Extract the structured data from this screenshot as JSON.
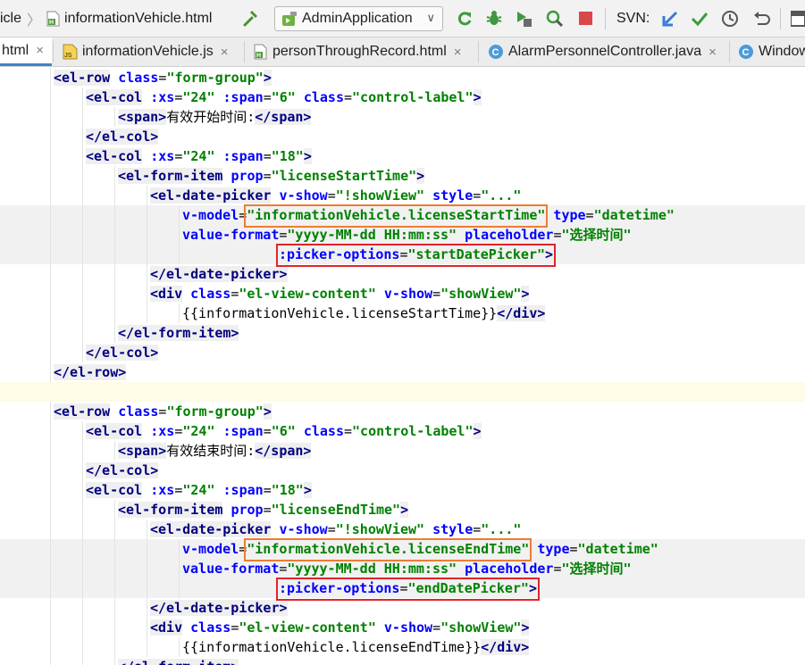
{
  "toolbar": {
    "breadcrumb_prefix": "icle",
    "breadcrumb_file": "informationVehicle.html",
    "run_config": "AdminApplication",
    "svn_label": "SVN:"
  },
  "tabs": [
    {
      "label": "html",
      "close": "×",
      "active": true
    },
    {
      "label": "informationVehicle.js",
      "close": "×",
      "active": false
    },
    {
      "label": "personThroughRecord.html",
      "close": "×",
      "active": false
    },
    {
      "label": "AlarmPersonnelController.java",
      "close": "×",
      "active": false
    },
    {
      "label": "Window",
      "close": "",
      "active": false
    }
  ],
  "colors": {
    "highlight_orange": "#ed7d31",
    "highlight_red": "#e2232b",
    "tag": "#000080",
    "attribute": "#0000ff",
    "value": "#008000"
  },
  "code_lines": [
    {
      "indent": 4,
      "tokens": [
        {
          "t": "t",
          "s": "<el-row"
        },
        {
          "t": "p",
          "s": " "
        },
        {
          "t": "a",
          "s": "class"
        },
        {
          "t": "p",
          "s": "="
        },
        {
          "t": "v",
          "s": "\"form-group\""
        },
        {
          "t": "t",
          "s": ">"
        }
      ]
    },
    {
      "indent": 8,
      "tokens": [
        {
          "t": "t",
          "s": "<el-col"
        },
        {
          "t": "p",
          "s": " "
        },
        {
          "t": "a",
          "s": ":xs"
        },
        {
          "t": "p",
          "s": "="
        },
        {
          "t": "v",
          "s": "\"24\""
        },
        {
          "t": "p",
          "s": " "
        },
        {
          "t": "a",
          "s": ":span"
        },
        {
          "t": "p",
          "s": "="
        },
        {
          "t": "v",
          "s": "\"6\""
        },
        {
          "t": "p",
          "s": " "
        },
        {
          "t": "a",
          "s": "class"
        },
        {
          "t": "p",
          "s": "="
        },
        {
          "t": "v",
          "s": "\"control-label\""
        },
        {
          "t": "t",
          "s": ">"
        }
      ]
    },
    {
      "indent": 12,
      "tokens": [
        {
          "t": "t",
          "s": "<span>"
        },
        {
          "t": "p",
          "s": "有效开始时间:"
        },
        {
          "t": "t",
          "s": "</span>"
        }
      ]
    },
    {
      "indent": 8,
      "tokens": [
        {
          "t": "t",
          "s": "</el-col>"
        }
      ]
    },
    {
      "indent": 8,
      "tokens": [
        {
          "t": "t",
          "s": "<el-col"
        },
        {
          "t": "p",
          "s": " "
        },
        {
          "t": "a",
          "s": ":xs"
        },
        {
          "t": "p",
          "s": "="
        },
        {
          "t": "v",
          "s": "\"24\""
        },
        {
          "t": "p",
          "s": " "
        },
        {
          "t": "a",
          "s": ":span"
        },
        {
          "t": "p",
          "s": "="
        },
        {
          "t": "v",
          "s": "\"18\""
        },
        {
          "t": "t",
          "s": ">"
        }
      ]
    },
    {
      "indent": 12,
      "tokens": [
        {
          "t": "t",
          "s": "<el-form-item"
        },
        {
          "t": "p",
          "s": " "
        },
        {
          "t": "a",
          "s": "prop"
        },
        {
          "t": "p",
          "s": "="
        },
        {
          "t": "v",
          "s": "\"licenseStartTime\""
        },
        {
          "t": "t",
          "s": ">"
        }
      ]
    },
    {
      "indent": 16,
      "tokens": [
        {
          "t": "t",
          "s": "<el-date-picker"
        },
        {
          "t": "p",
          "s": " "
        },
        {
          "t": "a",
          "s": "v-show"
        },
        {
          "t": "p",
          "s": "="
        },
        {
          "t": "v",
          "s": "\"!showView\""
        },
        {
          "t": "p",
          "s": " "
        },
        {
          "t": "a",
          "s": "style"
        },
        {
          "t": "p",
          "s": "="
        },
        {
          "t": "v",
          "s": "\"...\""
        }
      ]
    },
    {
      "indent": 20,
      "hl": true,
      "tokens": [
        {
          "t": "a",
          "s": "v-model"
        },
        {
          "t": "p",
          "s": "="
        },
        {
          "t": "v",
          "s": "\"informationVehicle.licenseStartTime\""
        },
        {
          "t": "p",
          "s": " "
        },
        {
          "t": "a",
          "s": "type"
        },
        {
          "t": "p",
          "s": "="
        },
        {
          "t": "v",
          "s": "\"datetime\""
        }
      ]
    },
    {
      "indent": 20,
      "hl": true,
      "tokens": [
        {
          "t": "a",
          "s": "value-format"
        },
        {
          "t": "p",
          "s": "="
        },
        {
          "t": "v",
          "s": "\"yyyy-MM-dd HH:mm:ss\""
        },
        {
          "t": "p",
          "s": " "
        },
        {
          "t": "a",
          "s": "placeholder"
        },
        {
          "t": "p",
          "s": "="
        },
        {
          "t": "v",
          "s": "\"选择时间\""
        }
      ]
    },
    {
      "indent": 32,
      "hl": true,
      "tokens": [
        {
          "t": "a",
          "s": ":picker-options"
        },
        {
          "t": "p",
          "s": "="
        },
        {
          "t": "v",
          "s": "\"startDatePicker\""
        },
        {
          "t": "t",
          "s": ">"
        }
      ]
    },
    {
      "indent": 16,
      "tokens": [
        {
          "t": "t",
          "s": "</el-date-picker>"
        }
      ]
    },
    {
      "indent": 16,
      "tokens": [
        {
          "t": "t",
          "s": "<div"
        },
        {
          "t": "p",
          "s": " "
        },
        {
          "t": "a",
          "s": "class"
        },
        {
          "t": "p",
          "s": "="
        },
        {
          "t": "v",
          "s": "\"el-view-content\""
        },
        {
          "t": "p",
          "s": " "
        },
        {
          "t": "a",
          "s": "v-show"
        },
        {
          "t": "p",
          "s": "="
        },
        {
          "t": "v",
          "s": "\"showView\""
        },
        {
          "t": "t",
          "s": ">"
        }
      ]
    },
    {
      "indent": 20,
      "tokens": [
        {
          "t": "p",
          "s": "{{informationVehicle.licenseStartTime}}"
        },
        {
          "t": "t",
          "s": "</div>"
        }
      ]
    },
    {
      "indent": 12,
      "tokens": [
        {
          "t": "t",
          "s": "</el-form-item>"
        }
      ]
    },
    {
      "indent": 8,
      "tokens": [
        {
          "t": "t",
          "s": "</el-col>"
        }
      ]
    },
    {
      "indent": 4,
      "tokens": [
        {
          "t": "t",
          "s": "</el-row>"
        }
      ]
    },
    {
      "indent": 0,
      "cur": true,
      "tokens": []
    },
    {
      "indent": 4,
      "tokens": [
        {
          "t": "t",
          "s": "<el-row"
        },
        {
          "t": "p",
          "s": " "
        },
        {
          "t": "a",
          "s": "class"
        },
        {
          "t": "p",
          "s": "="
        },
        {
          "t": "v",
          "s": "\"form-group\""
        },
        {
          "t": "t",
          "s": ">"
        }
      ]
    },
    {
      "indent": 8,
      "tokens": [
        {
          "t": "t",
          "s": "<el-col"
        },
        {
          "t": "p",
          "s": " "
        },
        {
          "t": "a",
          "s": ":xs"
        },
        {
          "t": "p",
          "s": "="
        },
        {
          "t": "v",
          "s": "\"24\""
        },
        {
          "t": "p",
          "s": " "
        },
        {
          "t": "a",
          "s": ":span"
        },
        {
          "t": "p",
          "s": "="
        },
        {
          "t": "v",
          "s": "\"6\""
        },
        {
          "t": "p",
          "s": " "
        },
        {
          "t": "a",
          "s": "class"
        },
        {
          "t": "p",
          "s": "="
        },
        {
          "t": "v",
          "s": "\"control-label\""
        },
        {
          "t": "t",
          "s": ">"
        }
      ]
    },
    {
      "indent": 12,
      "tokens": [
        {
          "t": "t",
          "s": "<span>"
        },
        {
          "t": "p",
          "s": "有效结束时间:"
        },
        {
          "t": "t",
          "s": "</span>"
        }
      ]
    },
    {
      "indent": 8,
      "tokens": [
        {
          "t": "t",
          "s": "</el-col>"
        }
      ]
    },
    {
      "indent": 8,
      "tokens": [
        {
          "t": "t",
          "s": "<el-col"
        },
        {
          "t": "p",
          "s": " "
        },
        {
          "t": "a",
          "s": ":xs"
        },
        {
          "t": "p",
          "s": "="
        },
        {
          "t": "v",
          "s": "\"24\""
        },
        {
          "t": "p",
          "s": " "
        },
        {
          "t": "a",
          "s": ":span"
        },
        {
          "t": "p",
          "s": "="
        },
        {
          "t": "v",
          "s": "\"18\""
        },
        {
          "t": "t",
          "s": ">"
        }
      ]
    },
    {
      "indent": 12,
      "tokens": [
        {
          "t": "t",
          "s": "<el-form-item"
        },
        {
          "t": "p",
          "s": " "
        },
        {
          "t": "a",
          "s": "prop"
        },
        {
          "t": "p",
          "s": "="
        },
        {
          "t": "v",
          "s": "\"licenseEndTime\""
        },
        {
          "t": "t",
          "s": ">"
        }
      ]
    },
    {
      "indent": 16,
      "tokens": [
        {
          "t": "t",
          "s": "<el-date-picker"
        },
        {
          "t": "p",
          "s": " "
        },
        {
          "t": "a",
          "s": "v-show"
        },
        {
          "t": "p",
          "s": "="
        },
        {
          "t": "v",
          "s": "\"!showView\""
        },
        {
          "t": "p",
          "s": " "
        },
        {
          "t": "a",
          "s": "style"
        },
        {
          "t": "p",
          "s": "="
        },
        {
          "t": "v",
          "s": "\"...\""
        }
      ]
    },
    {
      "indent": 20,
      "hl": true,
      "tokens": [
        {
          "t": "a",
          "s": "v-model"
        },
        {
          "t": "p",
          "s": "="
        },
        {
          "t": "v",
          "s": "\"informationVehicle.licenseEndTime\""
        },
        {
          "t": "p",
          "s": " "
        },
        {
          "t": "a",
          "s": "type"
        },
        {
          "t": "p",
          "s": "="
        },
        {
          "t": "v",
          "s": "\"datetime\""
        }
      ]
    },
    {
      "indent": 20,
      "hl": true,
      "tokens": [
        {
          "t": "a",
          "s": "value-format"
        },
        {
          "t": "p",
          "s": "="
        },
        {
          "t": "v",
          "s": "\"yyyy-MM-dd HH:mm:ss\""
        },
        {
          "t": "p",
          "s": " "
        },
        {
          "t": "a",
          "s": "placeholder"
        },
        {
          "t": "p",
          "s": "="
        },
        {
          "t": "v",
          "s": "\"选择时间\""
        }
      ]
    },
    {
      "indent": 32,
      "hl": true,
      "tokens": [
        {
          "t": "a",
          "s": ":picker-options"
        },
        {
          "t": "p",
          "s": "="
        },
        {
          "t": "v",
          "s": "\"endDatePicker\""
        },
        {
          "t": "t",
          "s": ">"
        }
      ]
    },
    {
      "indent": 16,
      "tokens": [
        {
          "t": "t",
          "s": "</el-date-picker>"
        }
      ]
    },
    {
      "indent": 16,
      "tokens": [
        {
          "t": "t",
          "s": "<div"
        },
        {
          "t": "p",
          "s": " "
        },
        {
          "t": "a",
          "s": "class"
        },
        {
          "t": "p",
          "s": "="
        },
        {
          "t": "v",
          "s": "\"el-view-content\""
        },
        {
          "t": "p",
          "s": " "
        },
        {
          "t": "a",
          "s": "v-show"
        },
        {
          "t": "p",
          "s": "="
        },
        {
          "t": "v",
          "s": "\"showView\""
        },
        {
          "t": "t",
          "s": ">"
        }
      ]
    },
    {
      "indent": 20,
      "tokens": [
        {
          "t": "p",
          "s": "{{informationVehicle.licenseEndTime}}"
        },
        {
          "t": "t",
          "s": "</div>"
        }
      ]
    },
    {
      "indent": 12,
      "tokens": [
        {
          "t": "t",
          "s": "</el-form-item>"
        }
      ]
    }
  ],
  "annotations": [
    {
      "line": 7,
      "token": 2,
      "color": "orange"
    },
    {
      "line": 9,
      "token": 0,
      "to_token": 3,
      "color": "red"
    },
    {
      "line": 24,
      "token": 2,
      "color": "orange"
    },
    {
      "line": 26,
      "token": 0,
      "to_token": 3,
      "color": "red"
    }
  ]
}
